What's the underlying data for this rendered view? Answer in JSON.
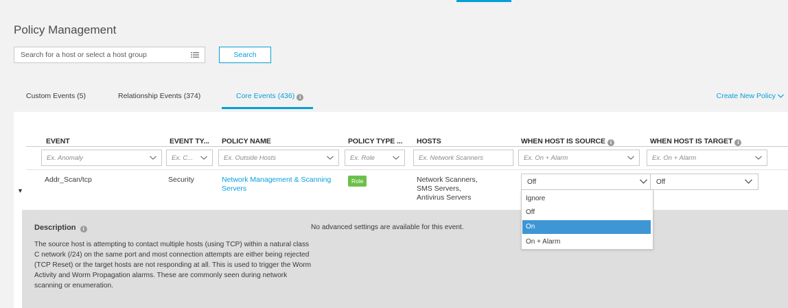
{
  "page": {
    "title": "Policy Management"
  },
  "search": {
    "placeholder": "Search for a host or select a host group",
    "button_label": "Search"
  },
  "tabs": [
    {
      "label": "Custom Events (5)"
    },
    {
      "label": "Relationship Events (374)"
    },
    {
      "label": "Core Events (436)"
    }
  ],
  "create_link": "Create New Policy",
  "columns": [
    {
      "label": "EVENT"
    },
    {
      "label": "EVENT TY..."
    },
    {
      "label": "POLICY NAME"
    },
    {
      "label": "POLICY TYPE ..."
    },
    {
      "label": "HOSTS"
    },
    {
      "label": "WHEN HOST IS SOURCE"
    },
    {
      "label": "WHEN HOST IS TARGET"
    }
  ],
  "filters": [
    {
      "placeholder": "Ex. Anomaly"
    },
    {
      "placeholder": "Ex. C..."
    },
    {
      "placeholder": "Ex. Outside Hosts"
    },
    {
      "placeholder": "Ex. Role"
    },
    {
      "placeholder": "Ex. Network Scanners"
    },
    {
      "placeholder": "Ex. On + Alarm"
    },
    {
      "placeholder": "Ex. On + Alarm"
    }
  ],
  "row": {
    "event": "Addr_Scan/tcp",
    "event_type": "Security",
    "policy_name_line1": "Network Management & Scanning",
    "policy_name_line2": "Servers",
    "policy_type": "Role",
    "hosts": [
      "Network Scanners,",
      "SMS Servers,",
      "Antivirus Servers"
    ],
    "source_value": "Off",
    "target_value": "Off"
  },
  "dropdown": {
    "options": [
      "Ignore",
      "Off",
      "On",
      "On + Alarm"
    ],
    "highlighted": "On"
  },
  "details": {
    "title": "Description",
    "text": "The source host is attempting to contact multiple hosts (using TCP) within a natural class C network (/24) on the same port and most connection attempts are either being rejected (TCP Reset) or the target hosts are not responding at all. This is used to trigger the Worm Activity and Worm Propagation alarms. These are commonly seen during network scanning or enumeration.",
    "no_advanced": "No advanced settings are available for this event."
  },
  "colors": {
    "accent": "#049fd9",
    "role_badge": "#6cc04a",
    "selected_option": "#3e96d4"
  }
}
